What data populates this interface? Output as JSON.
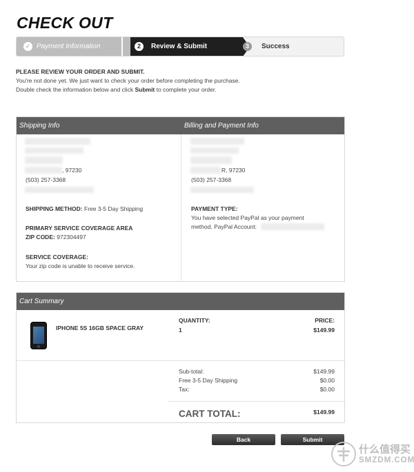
{
  "page": {
    "title": "CHECK OUT"
  },
  "steps": [
    {
      "number": "✓",
      "label": "Payment Information",
      "state": "completed"
    },
    {
      "number": "2",
      "label": "Review & Submit",
      "state": "active"
    },
    {
      "number": "3",
      "label": "Success",
      "state": "pending"
    }
  ],
  "intro": {
    "heading": "PLEASE REVIEW YOUR ORDER AND SUBMIT.",
    "line1": "You're not done yet. We just want to check your order before completing the purchase.",
    "line2_prefix": "Double check the information below and click ",
    "line2_bold": "Submit",
    "line2_suffix": " to complete your order."
  },
  "shipping": {
    "header": "Shipping Info",
    "city_line": ", 97230",
    "phone": "(503) 257-3368",
    "method_label": "SHIPPING METHOD:",
    "method_value": " Free 3-5 Day Shipping",
    "coverage_area_label": "PRIMARY SERVICE COVERAGE AREA",
    "zip_label": "ZIP CODE:",
    "zip_value": " 972304497",
    "coverage_label": "SERVICE COVERAGE:",
    "coverage_value": "Your zip code is unable to receive service."
  },
  "billing": {
    "header": "Billing and Payment Info",
    "city_line": "R, 97230",
    "phone": "(503) 257-3368",
    "payment_type_label": "PAYMENT TYPE:",
    "payment_line1": "You have selected PayPal as your payment",
    "payment_line2": "method. PayPal Account:"
  },
  "cart": {
    "header": "Cart Summary",
    "item_name": "IPHONE 5S 16GB SPACE GRAY",
    "quantity_label": "QUANTITY:",
    "quantity_value": "1",
    "price_label": "PRICE:",
    "price_value": "$149.99",
    "subtotal_label": "Sub-total:",
    "subtotal_value": "$149.99",
    "shipping_label": "Free 3-5 Day Shipping",
    "shipping_value": "$0.00",
    "tax_label": "Tax:",
    "tax_value": "$0.00",
    "total_label": "CART TOTAL:",
    "total_value": "$149.99"
  },
  "buttons": {
    "back": "Back",
    "submit": "Submit"
  },
  "watermark": {
    "line1": "什么值得买",
    "line2": "SMZDM.COM"
  },
  "colors": {
    "panel_header": "#5f5f5f",
    "active_step": "#1f1f1f",
    "completed_step": "#bdbdbd",
    "button": "#3a3a3a"
  }
}
